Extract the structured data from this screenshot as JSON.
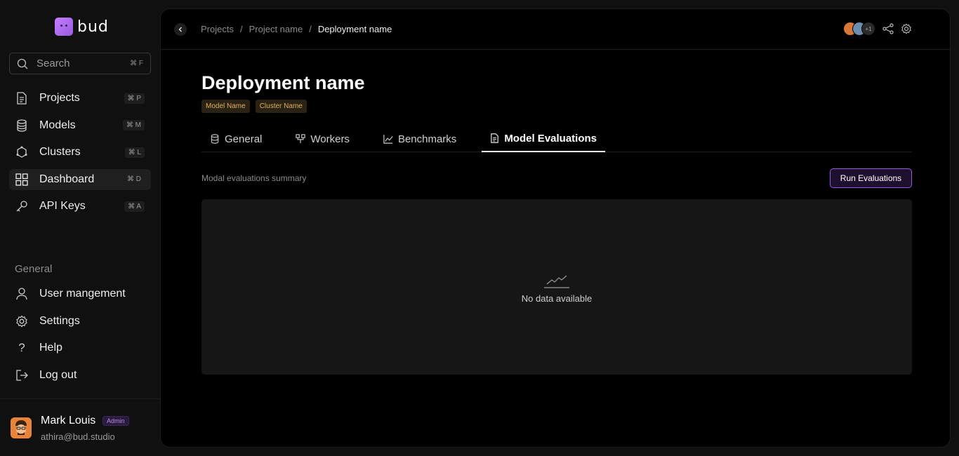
{
  "brand": {
    "name": "bud",
    "accent": "#965CDE"
  },
  "search": {
    "placeholder": "Search",
    "shortcut": "⌘ F"
  },
  "sidebar": {
    "items": [
      {
        "label": "Projects",
        "shortcut": "⌘ P",
        "icon": "document-icon"
      },
      {
        "label": "Models",
        "shortcut": "⌘ M",
        "icon": "database-icon"
      },
      {
        "label": "Clusters",
        "shortcut": "⌘ L",
        "icon": "cluster-icon"
      },
      {
        "label": "Dashboard",
        "shortcut": "⌘ D",
        "icon": "dashboard-icon",
        "active": true
      },
      {
        "label": "API Keys",
        "shortcut": "⌘ A",
        "icon": "key-icon"
      }
    ],
    "section_label": "General",
    "general_items": [
      {
        "label": "User mangement",
        "icon": "user-icon"
      },
      {
        "label": "Settings",
        "icon": "gear-icon"
      },
      {
        "label": "Help",
        "icon": "help-icon"
      },
      {
        "label": "Log out",
        "icon": "logout-icon"
      }
    ]
  },
  "user": {
    "name": "Mark Louis",
    "role": "Admin",
    "email": "athira@bud.studio"
  },
  "header": {
    "breadcrumbs": [
      "Projects",
      "Project name",
      "Deployment name"
    ],
    "separator": "/",
    "extra_collaborators": "+1"
  },
  "page": {
    "title": "Deployment name",
    "tags": [
      "Model Name",
      "Cluster Name"
    ],
    "tabs": [
      {
        "label": "General",
        "icon": "database-icon"
      },
      {
        "label": "Workers",
        "icon": "workers-icon"
      },
      {
        "label": "Benchmarks",
        "icon": "chart-icon"
      },
      {
        "label": "Model Evaluations",
        "icon": "document-icon",
        "active": true
      }
    ],
    "summary_label": "Modal evaluations summary",
    "run_button": "Run Evaluations",
    "empty_text": "No data available"
  }
}
